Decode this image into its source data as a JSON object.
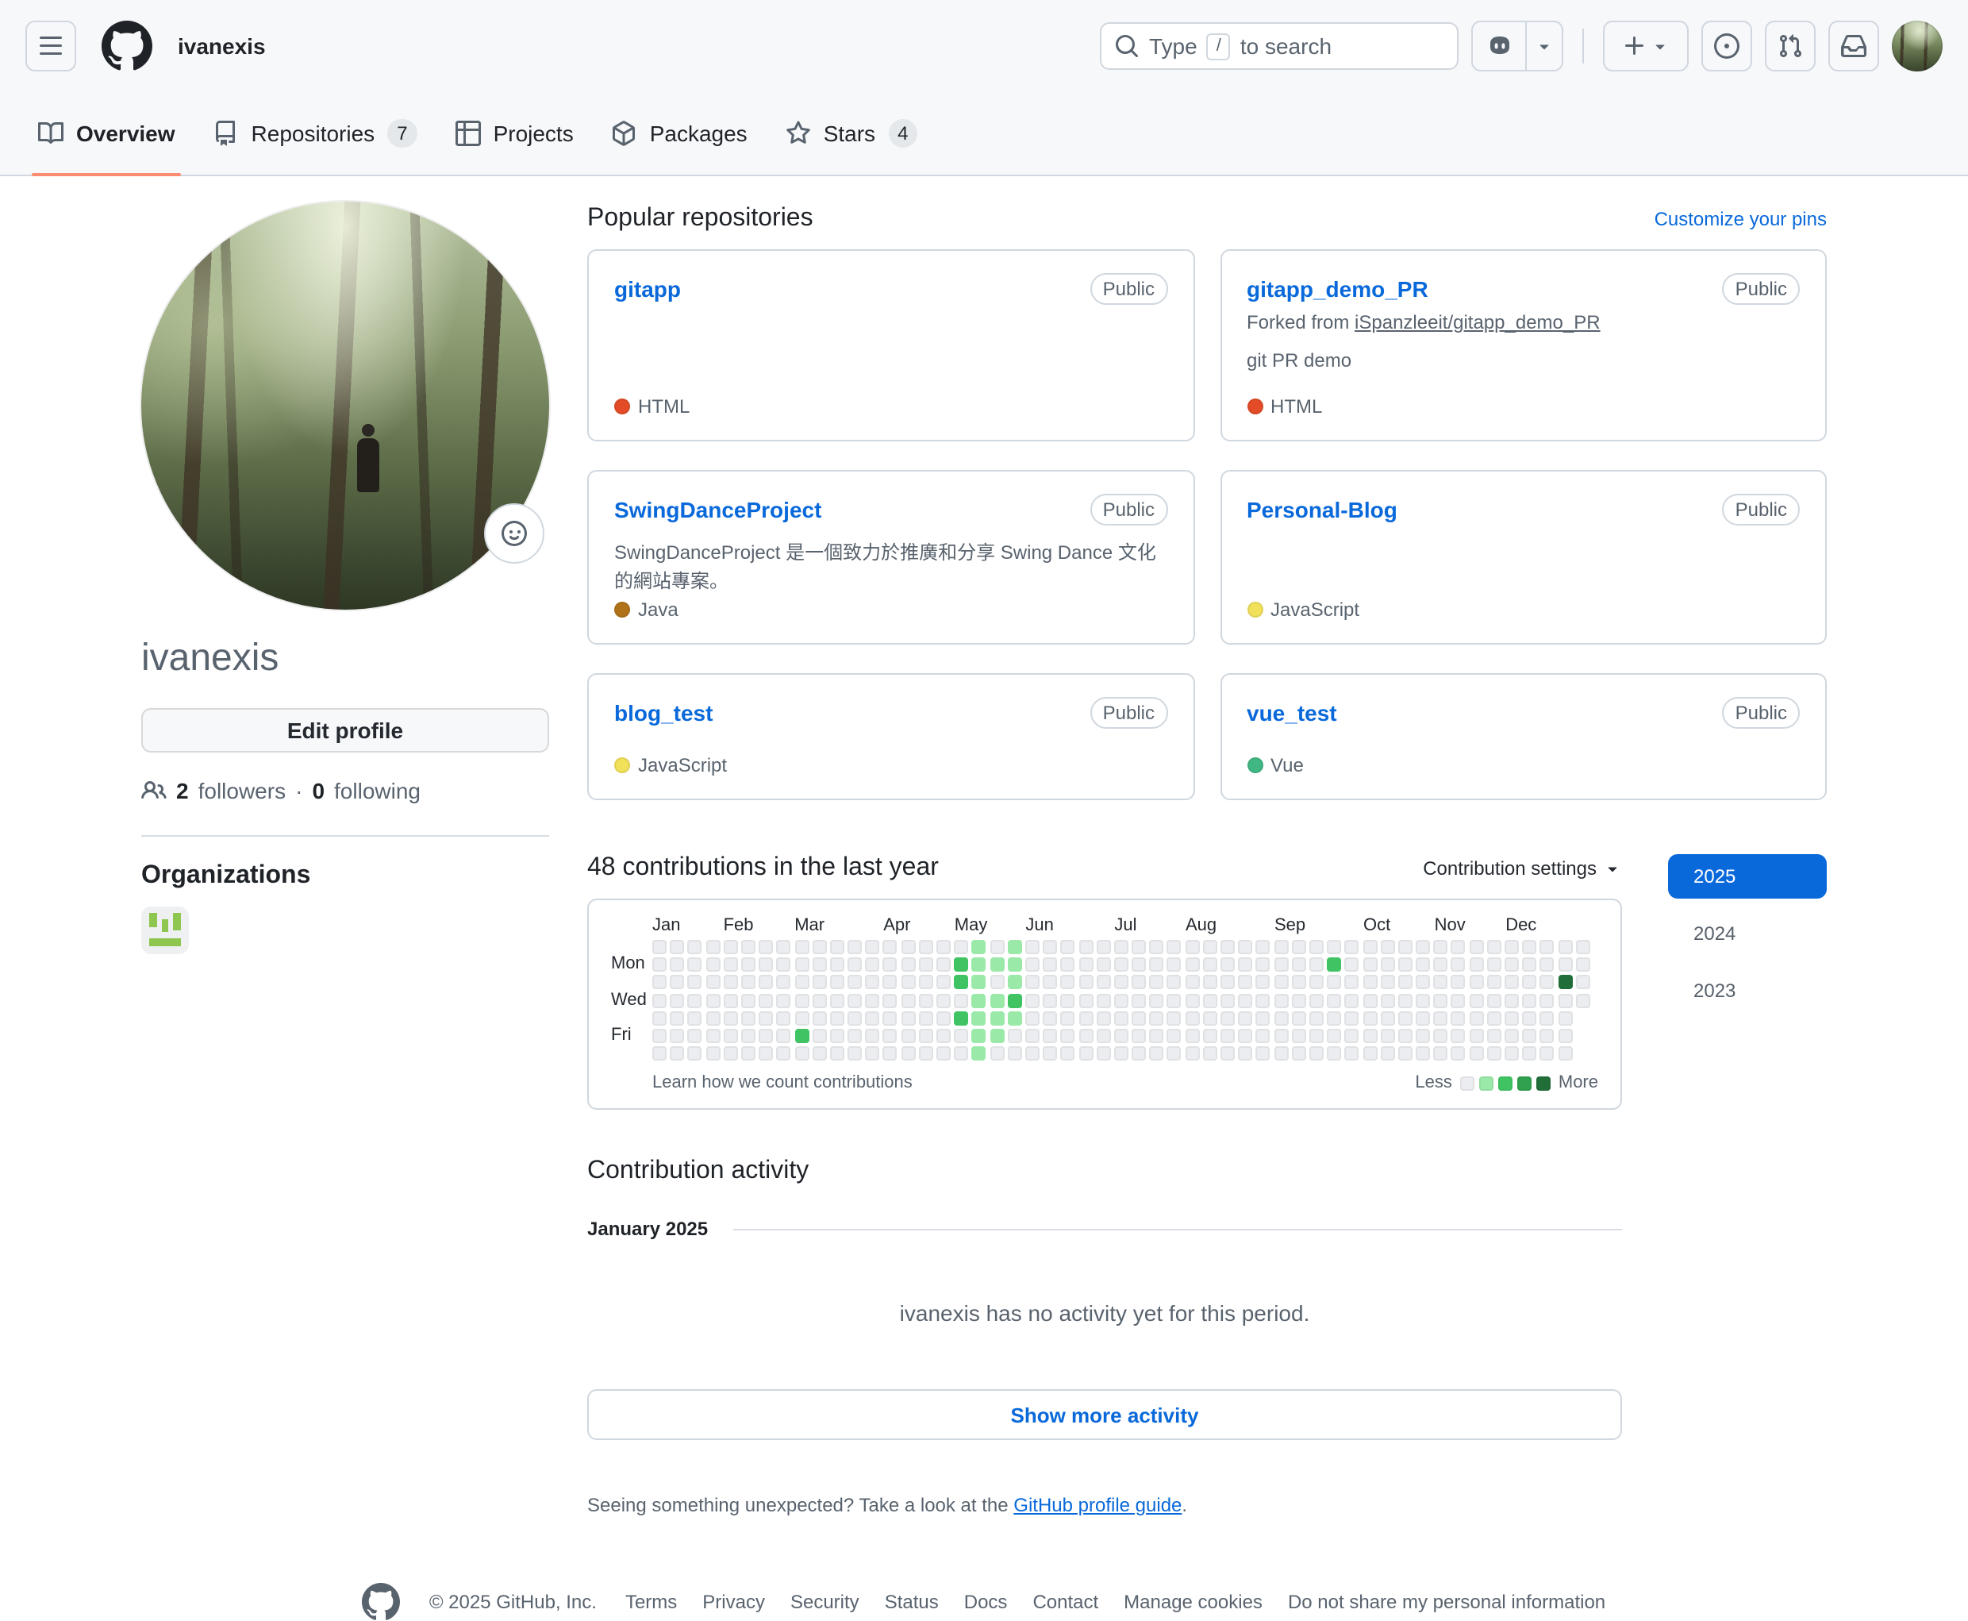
{
  "header": {
    "username": "ivanexis",
    "search_placeholder_pre": "Type",
    "search_slash_key": "/",
    "search_placeholder_post": "to search"
  },
  "tabs": [
    {
      "label": "Overview",
      "active": true
    },
    {
      "label": "Repositories",
      "count": "7"
    },
    {
      "label": "Projects"
    },
    {
      "label": "Packages"
    },
    {
      "label": "Stars",
      "count": "4"
    }
  ],
  "profile": {
    "username": "ivanexis",
    "edit_button": "Edit profile",
    "followers_count": "2",
    "followers_label": "followers",
    "dot_separator": "·",
    "following_count": "0",
    "following_label": "following",
    "organizations_title": "Organizations"
  },
  "popular": {
    "title": "Popular repositories",
    "customize_link": "Customize your pins",
    "repos": [
      {
        "name": "gitapp",
        "visibility": "Public",
        "language": "HTML",
        "lang_color": "#e34c26"
      },
      {
        "name": "gitapp_demo_PR",
        "visibility": "Public",
        "forked_prefix": "Forked from",
        "forked_from": "iSpanzleeit/gitapp_demo_PR",
        "description": "git PR demo",
        "language": "HTML",
        "lang_color": "#e34c26"
      },
      {
        "name": "SwingDanceProject",
        "visibility": "Public",
        "description": "SwingDanceProject 是一個致力於推廣和分享 Swing Dance 文化的網站專案。",
        "language": "Java",
        "lang_color": "#b07219"
      },
      {
        "name": "Personal-Blog",
        "visibility": "Public",
        "language": "JavaScript",
        "lang_color": "#f1e05a"
      },
      {
        "name": "blog_test",
        "visibility": "Public",
        "language": "JavaScript",
        "lang_color": "#f1e05a"
      },
      {
        "name": "vue_test",
        "visibility": "Public",
        "language": "Vue",
        "lang_color": "#41b883"
      }
    ]
  },
  "contributions": {
    "title": "48 contributions in the last year",
    "settings_label": "Contribution settings",
    "months": [
      "Jan",
      "Feb",
      "Mar",
      "Apr",
      "May",
      "Jun",
      "Jul",
      "Aug",
      "Sep",
      "Oct",
      "Nov",
      "Dec"
    ],
    "month_cols": [
      0,
      4,
      8,
      13,
      17,
      21,
      26,
      30,
      35,
      40,
      44,
      48
    ],
    "day_rows": {
      "1": "Mon",
      "3": "Wed",
      "5": "Fri"
    },
    "weeks": 53,
    "last_week_days": 4,
    "level_colors": [
      "#ebedf0",
      "#9be9a8",
      "#40c463",
      "#30a14e",
      "#216e39"
    ],
    "cells": [
      [
        8,
        5,
        2
      ],
      [
        17,
        1,
        2
      ],
      [
        17,
        2,
        2
      ],
      [
        17,
        4,
        2
      ],
      [
        18,
        0,
        1
      ],
      [
        18,
        1,
        1
      ],
      [
        18,
        2,
        1
      ],
      [
        18,
        3,
        1
      ],
      [
        18,
        4,
        1
      ],
      [
        18,
        5,
        1
      ],
      [
        18,
        6,
        1
      ],
      [
        19,
        1,
        1
      ],
      [
        19,
        3,
        1
      ],
      [
        19,
        4,
        1
      ],
      [
        19,
        5,
        1
      ],
      [
        20,
        0,
        1
      ],
      [
        20,
        1,
        1
      ],
      [
        20,
        2,
        1
      ],
      [
        20,
        3,
        2
      ],
      [
        20,
        4,
        1
      ],
      [
        38,
        1,
        2
      ],
      [
        51,
        2,
        4
      ]
    ],
    "learn_link": "Learn how we count contributions",
    "less_label": "Less",
    "more_label": "More",
    "years": [
      {
        "label": "2025",
        "active": true
      },
      {
        "label": "2024",
        "active": false
      },
      {
        "label": "2023",
        "active": false
      }
    ]
  },
  "activity": {
    "title": "Contribution activity",
    "period": "January 2025",
    "empty_message": "ivanexis has no activity yet for this period.",
    "show_more": "Show more activity",
    "footnote_prefix": "Seeing something unexpected? Take a look at the ",
    "footnote_link": "GitHub profile guide",
    "footnote_suffix": "."
  },
  "footer": {
    "copyright": "© 2025 GitHub, Inc.",
    "links": [
      "Terms",
      "Privacy",
      "Security",
      "Status",
      "Docs",
      "Contact",
      "Manage cookies",
      "Do not share my personal information"
    ]
  }
}
